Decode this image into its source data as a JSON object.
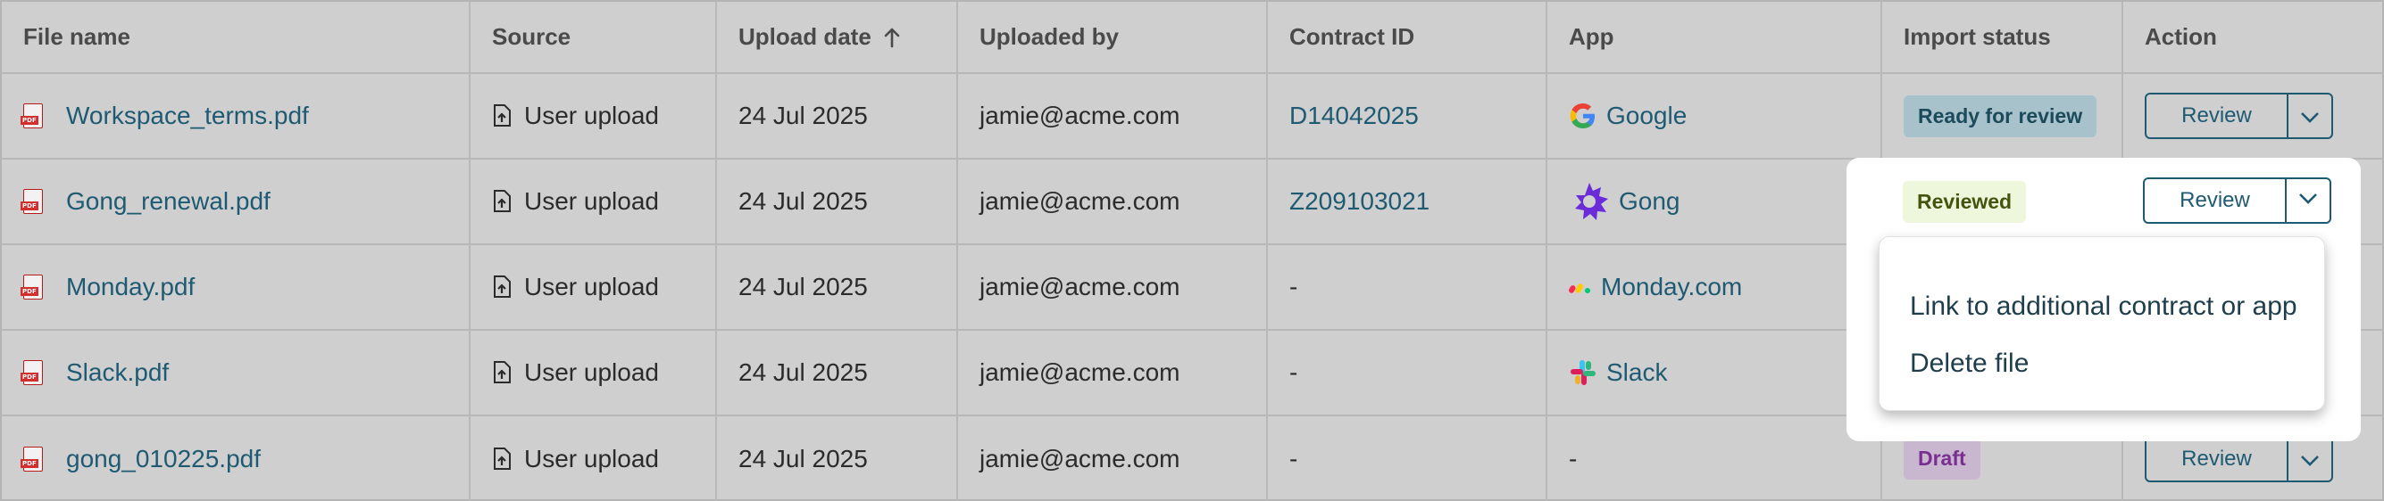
{
  "headers": {
    "file_name": "File name",
    "source": "Source",
    "upload_date": "Upload date",
    "uploaded_by": "Uploaded by",
    "contract_id": "Contract ID",
    "app": "App",
    "import_status": "Import status",
    "action": "Action"
  },
  "sort": {
    "column": "upload_date",
    "direction": "ascending",
    "icon": "arrow-up-icon"
  },
  "rows": [
    {
      "file": "Workspace_terms.pdf",
      "source": "User upload",
      "date": "24 Jul 2025",
      "by": "jamie@acme.com",
      "contract": "D14042025",
      "app": "Google",
      "app_icon": "google-icon",
      "status": "Ready for review",
      "action": "Review"
    },
    {
      "file": "Gong_renewal.pdf",
      "source": "User upload",
      "date": "24 Jul 2025",
      "by": "jamie@acme.com",
      "contract": "Z209103021",
      "app": "Gong",
      "app_icon": "gong-icon",
      "status": "Reviewed",
      "action": "Review"
    },
    {
      "file": "Monday.pdf",
      "source": "User upload",
      "date": "24 Jul 2025",
      "by": "jamie@acme.com",
      "contract": "-",
      "app": "Monday.com",
      "app_icon": "monday-icon",
      "status": "",
      "action": ""
    },
    {
      "file": "Slack.pdf",
      "source": "User upload",
      "date": "24 Jul 2025",
      "by": "jamie@acme.com",
      "contract": "-",
      "app": "Slack",
      "app_icon": "slack-icon",
      "status": "",
      "action": ""
    },
    {
      "file": "gong_010225.pdf",
      "source": "User upload",
      "date": "24 Jul 2025",
      "by": "jamie@acme.com",
      "contract": "-",
      "app": "-",
      "app_icon": "",
      "status": "Draft",
      "action": "Review"
    }
  ],
  "dropdown_menu": {
    "items": [
      "Link to additional contract or app",
      "Delete file"
    ]
  },
  "colors": {
    "link": "#1f5a73",
    "overlay": "#cfcfcf",
    "ready_badge": "#a8c2cc",
    "reviewed_badge": "#eef6dc",
    "draft_badge_text": "#7b2e92"
  }
}
